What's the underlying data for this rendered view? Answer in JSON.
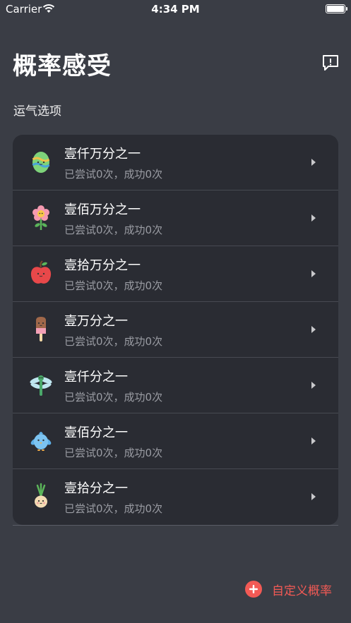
{
  "status_bar": {
    "carrier": "Carrier",
    "time": "4:34 PM"
  },
  "header": {
    "title": "概率感受",
    "feedback_icon": "feedback-icon"
  },
  "section": {
    "label": "运气选项"
  },
  "options": [
    {
      "title": "壹仟万分之一",
      "subtitle": "已尝试0次，成功0次",
      "icon": "easter-egg-icon"
    },
    {
      "title": "壹佰万分之一",
      "subtitle": "已尝试0次，成功0次",
      "icon": "flower-icon"
    },
    {
      "title": "壹拾万分之一",
      "subtitle": "已尝试0次，成功0次",
      "icon": "apple-icon"
    },
    {
      "title": "壹万分之一",
      "subtitle": "已尝试0次，成功0次",
      "icon": "popsicle-icon"
    },
    {
      "title": "壹仟分之一",
      "subtitle": "已尝试0次，成功0次",
      "icon": "dragonfly-icon"
    },
    {
      "title": "壹佰分之一",
      "subtitle": "已尝试0次，成功0次",
      "icon": "bird-icon"
    },
    {
      "title": "壹拾分之一",
      "subtitle": "已尝试0次，成功0次",
      "icon": "onion-icon"
    }
  ],
  "fab": {
    "label": "自定义概率",
    "icon": "add-circle-icon"
  },
  "colors": {
    "background": "#3a3d45",
    "card": "#2a2c33",
    "accent": "#f25a55",
    "subtext": "#9a9ca3"
  }
}
